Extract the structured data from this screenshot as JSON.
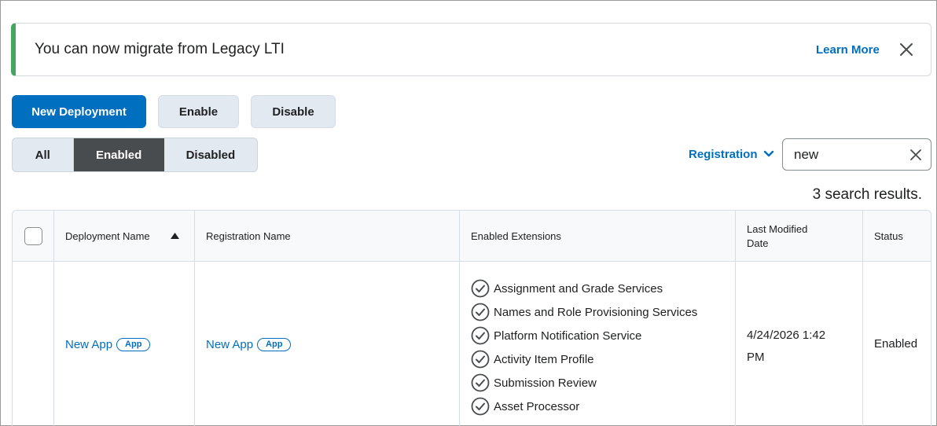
{
  "alert": {
    "message": "You can now migrate from Legacy LTI",
    "link_label": "Learn More",
    "accent_color": "#46a661"
  },
  "toolbar": {
    "new_deployment_label": "New Deployment",
    "enable_label": "Enable",
    "disable_label": "Disable"
  },
  "filter": {
    "options": [
      "All",
      "Enabled",
      "Disabled"
    ],
    "selected": "Enabled"
  },
  "registration_dropdown": {
    "label": "Registration"
  },
  "search": {
    "value": "new"
  },
  "results": {
    "text": "3 search results."
  },
  "table": {
    "headers": {
      "deployment_name": "Deployment Name",
      "registration_name": "Registration Name",
      "enabled_extensions": "Enabled Extensions",
      "last_modified_line1": "Last Modified",
      "last_modified_line2": "Date",
      "status": "Status"
    },
    "rows": [
      {
        "deployment_name": "New App",
        "deployment_badge": "App",
        "registration_name": "New App",
        "registration_badge": "App",
        "extensions": [
          "Assignment and Grade Services",
          "Names and Role Provisioning Services",
          "Platform Notification Service",
          "Activity Item Profile",
          "Submission Review",
          "Asset Processor"
        ],
        "last_modified_line1": "4/24/2026 1:42",
        "last_modified_line2": "PM",
        "status": "Enabled"
      }
    ]
  },
  "colors": {
    "primary": "#006fbf",
    "selected_segment": "#494c4e",
    "secondary_button": "#e3e9f1"
  }
}
